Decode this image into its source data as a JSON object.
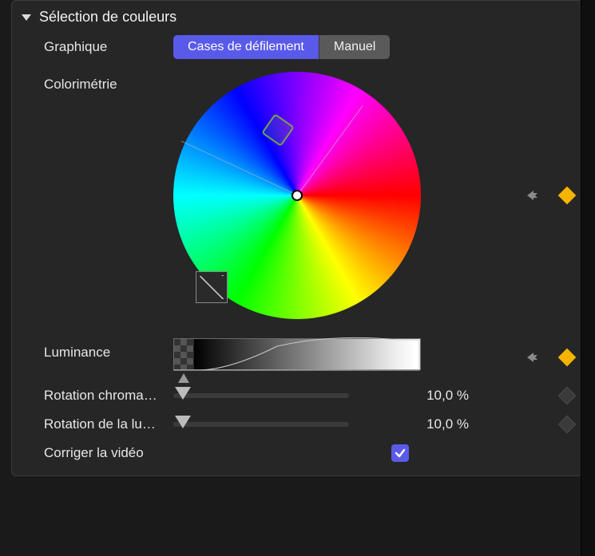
{
  "section": {
    "title": "Sélection de couleurs"
  },
  "graphique": {
    "label": "Graphique",
    "segments": {
      "scroll": "Cases de défilement",
      "manual": "Manuel"
    },
    "active": "scroll"
  },
  "colorimetrie": {
    "label": "Colorimétrie"
  },
  "luminance": {
    "label": "Luminance"
  },
  "rotation_chroma": {
    "label": "Rotation chroma…",
    "value": "10,0 %"
  },
  "rotation_lum": {
    "label": "Rotation de la lu…",
    "value": "10,0 %"
  },
  "corriger": {
    "label": "Corriger la vidéo",
    "checked": true
  }
}
